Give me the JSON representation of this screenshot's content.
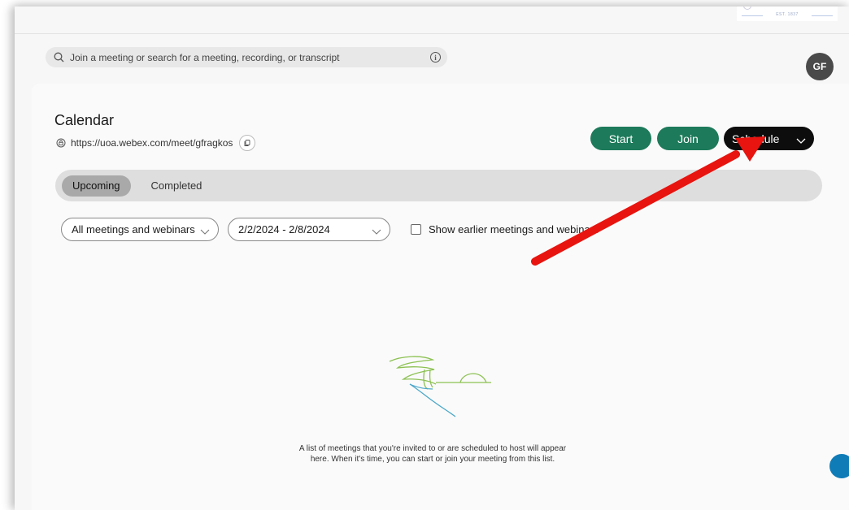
{
  "search": {
    "placeholder": "Join a meeting or search for a meeting, recording, or transcript",
    "icon": "search-icon",
    "info_icon": "info-icon"
  },
  "header": {
    "logo_text": "EST. 1837"
  },
  "user": {
    "initials": "GF"
  },
  "calendar": {
    "title": "Calendar",
    "url": "https://uoa.webex.com/meet/gfragkos"
  },
  "actions": {
    "start": "Start",
    "join": "Join",
    "schedule": "Schedule"
  },
  "tabs": [
    {
      "label": "Upcoming",
      "active": true
    },
    {
      "label": "Completed",
      "active": false
    }
  ],
  "filters": {
    "meeting_type": "All meetings and webinars",
    "date_range": "2/2/2024 - 2/8/2024",
    "show_earlier_label": "Show earlier meetings and webinars",
    "show_earlier_checked": false
  },
  "empty_state": {
    "line1": "A list of meetings that you're invited to or are scheduled to host will appear",
    "line2": "here. When it's time, you can start or join your meeting from this list."
  },
  "colors": {
    "primary_green": "#1d7a5a",
    "schedule_black": "#0d0d0d",
    "annotation_arrow": "#e8140f",
    "help_blue": "#0f7cb7"
  }
}
